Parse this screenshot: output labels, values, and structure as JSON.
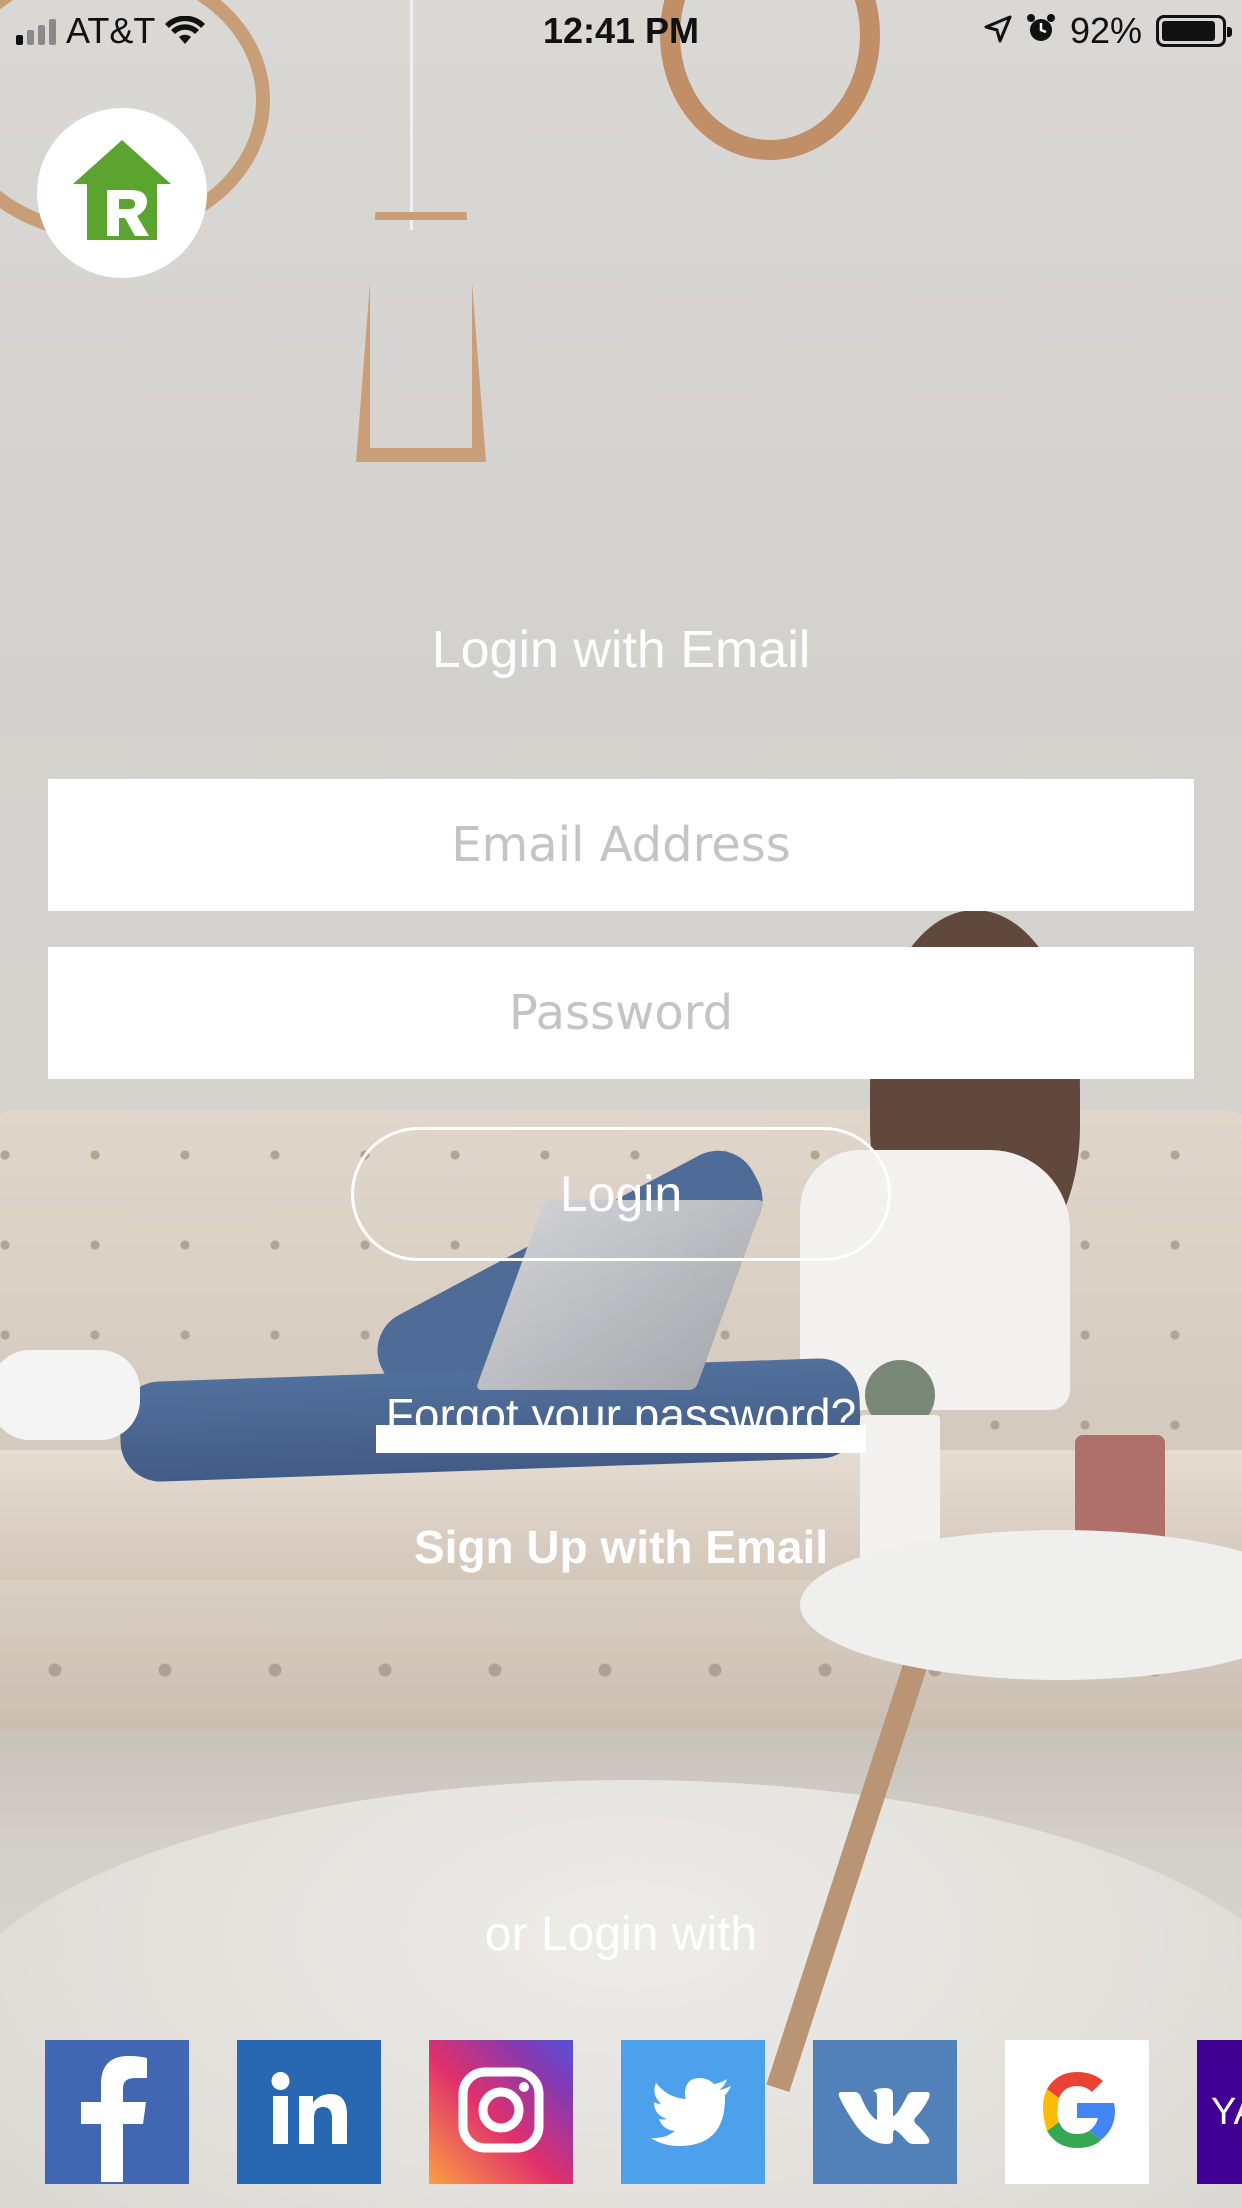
{
  "status_bar": {
    "carrier": "AT&T",
    "time": "12:41 PM",
    "battery": "92%",
    "battery_level": 0.92
  },
  "logo": {
    "icon": "house-r-logo-icon",
    "color": "#5aa42f"
  },
  "form": {
    "title": "Login with Email",
    "email_placeholder": "Email Address",
    "password_placeholder": "Password",
    "login_label": "Login",
    "forgot_label": "Forgot your password?",
    "signup_label": "Sign Up with Email"
  },
  "social": {
    "heading": "or Login with",
    "providers": [
      {
        "name": "facebook",
        "icon": "facebook-icon",
        "color": "#4267b2"
      },
      {
        "name": "linkedin",
        "icon": "linkedin-icon",
        "color": "#2867b2"
      },
      {
        "name": "instagram",
        "icon": "instagram-icon",
        "color": "#e1306c"
      },
      {
        "name": "twitter",
        "icon": "twitter-icon",
        "color": "#4da1ec"
      },
      {
        "name": "vk",
        "icon": "vk-icon",
        "color": "#5181b8"
      },
      {
        "name": "google",
        "icon": "google-icon",
        "color": "#ffffff"
      },
      {
        "name": "yahoo",
        "icon": "yahoo-icon",
        "color": "#410093",
        "visible_text": "YA"
      }
    ]
  }
}
